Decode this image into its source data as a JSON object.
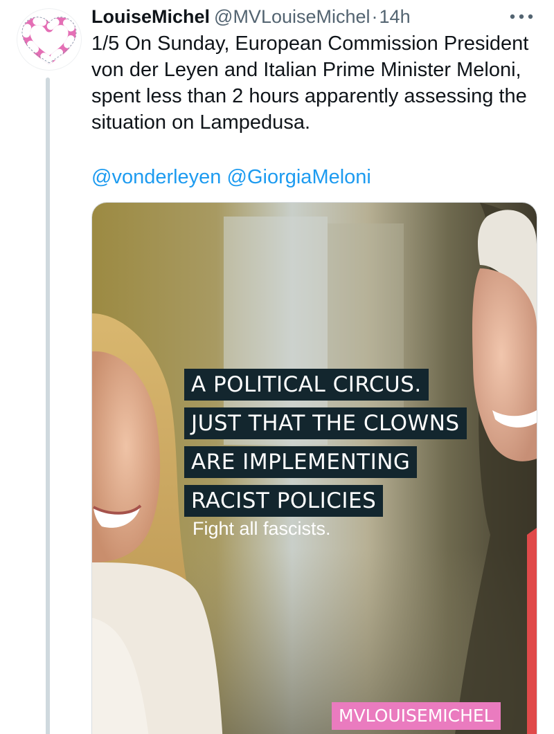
{
  "tweet": {
    "author": {
      "display_name": "LouiseMichel",
      "handle": "@MVLouiseMichel",
      "avatar_icon": "pink-heart-lifebuoy-icon"
    },
    "separator": "·",
    "time": "14h",
    "text": "1/5 On Sunday, European Commission President von der Leyen and Italian Prime Minister Meloni, spent less than 2 hours apparently assessing the situation on Lampedusa.",
    "mentions": [
      "@vonderleyen",
      "@GiorgiaMeloni"
    ],
    "more_icon": "more-options-icon",
    "media": {
      "overlay_lines": [
        "A POLITICAL CIRCUS.",
        "JUST THAT THE CLOWNS",
        "ARE IMPLEMENTING",
        "RACIST POLICIES"
      ],
      "subline": "Fight all fascists.",
      "watermark": "MVLOUISEMICHEL"
    }
  },
  "colors": {
    "link": "#1d9bf0",
    "text_primary": "#0f1419",
    "text_secondary": "#536471",
    "thread_line": "#cfd9de",
    "overlay_box": "#13262e",
    "watermark_bg": "#ea7bbf",
    "avatar_pink": "#e46fb5"
  }
}
